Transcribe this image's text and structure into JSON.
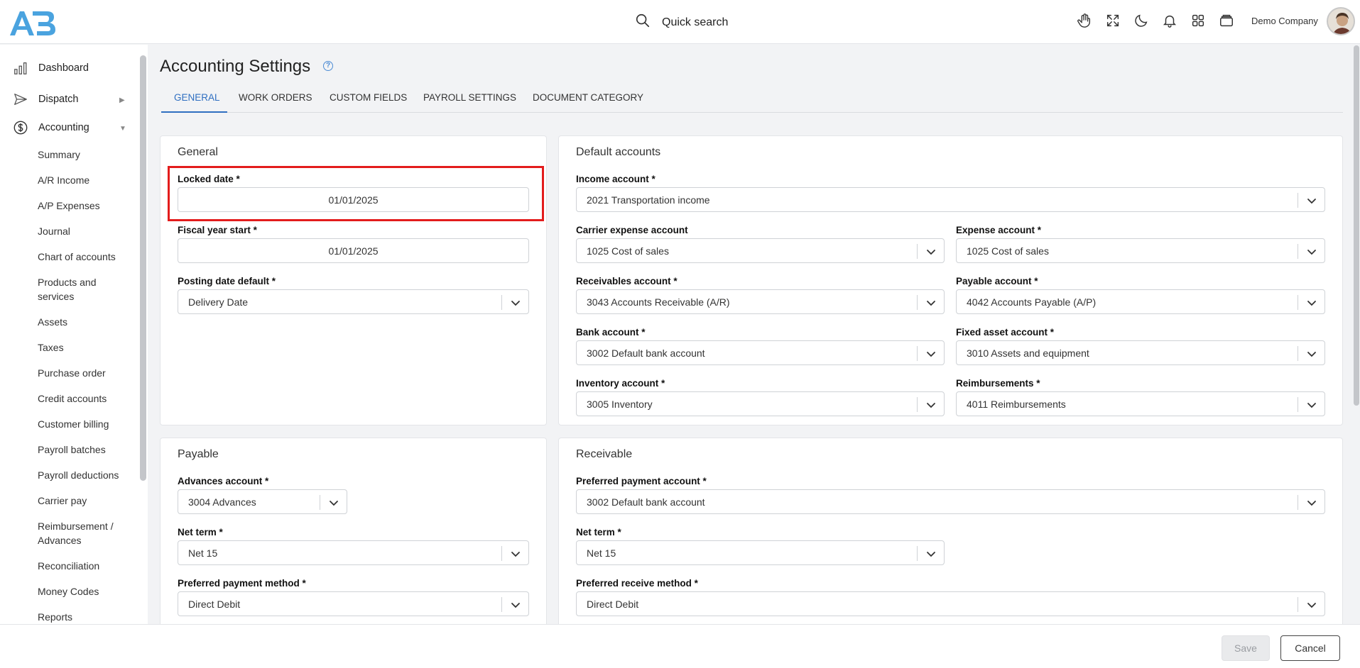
{
  "header": {
    "search_label": "Quick search",
    "company": "Demo Company",
    "icons": [
      "hand-icon",
      "fullscreen-icon",
      "moon-icon",
      "bell-icon",
      "apps-grid-icon",
      "wallet-icon"
    ]
  },
  "sidebar": {
    "main": [
      {
        "label": "Dashboard",
        "icon": "bar-chart-icon"
      },
      {
        "label": "Dispatch",
        "icon": "send-icon",
        "arrow": "▶"
      },
      {
        "label": "Accounting",
        "icon": "dollar-circle-icon",
        "arrow": "▼"
      }
    ],
    "sub": [
      "Summary",
      "A/R Income",
      "A/P Expenses",
      "Journal",
      "Chart of accounts",
      "Products and services",
      "Assets",
      "Taxes",
      "Purchase order",
      "Credit accounts",
      "Customer billing",
      "Payroll batches",
      "Payroll deductions",
      "Carrier pay",
      "Reimbursement / Advances",
      "Reconciliation",
      "Money Codes",
      "Reports"
    ]
  },
  "page": {
    "title": "Accounting Settings",
    "help": "?",
    "tabs": [
      "GENERAL",
      "WORK ORDERS",
      "CUSTOM FIELDS",
      "PAYROLL SETTINGS",
      "DOCUMENT CATEGORY"
    ],
    "active_tab": "GENERAL"
  },
  "general": {
    "title": "General",
    "locked_date": {
      "label": "Locked date *",
      "value": "01/01/2025"
    },
    "fiscal_year_start": {
      "label": "Fiscal year start *",
      "value": "01/01/2025"
    },
    "posting_date_default": {
      "label": "Posting date default *",
      "value": "Delivery Date"
    }
  },
  "default_accounts": {
    "title": "Default accounts",
    "income": {
      "label": "Income account *",
      "value": "2021 Transportation income"
    },
    "carrier_expense": {
      "label": "Carrier expense account",
      "value": "1025 Cost of sales"
    },
    "expense": {
      "label": "Expense account *",
      "value": "1025 Cost of sales"
    },
    "receivables": {
      "label": "Receivables account *",
      "value": "3043 Accounts Receivable (A/R)"
    },
    "payable": {
      "label": "Payable account *",
      "value": "4042 Accounts Payable (A/P)"
    },
    "bank": {
      "label": "Bank account *",
      "value": "3002 Default bank account"
    },
    "fixed_asset": {
      "label": "Fixed asset account *",
      "value": "3010 Assets and equipment"
    },
    "inventory": {
      "label": "Inventory account *",
      "value": "3005 Inventory"
    },
    "reimbursements": {
      "label": "Reimbursements *",
      "value": "4011 Reimbursements"
    }
  },
  "payable": {
    "title": "Payable",
    "advances": {
      "label": "Advances account *",
      "value": "3004 Advances"
    },
    "net_term": {
      "label": "Net term *",
      "value": "Net 15"
    },
    "payment_method": {
      "label": "Preferred payment method *",
      "value": "Direct Debit"
    }
  },
  "receivable": {
    "title": "Receivable",
    "payment_account": {
      "label": "Preferred payment account *",
      "value": "3002 Default bank account"
    },
    "net_term": {
      "label": "Net term *",
      "value": "Net 15"
    },
    "receive_method": {
      "label": "Preferred receive method *",
      "value": "Direct Debit"
    }
  },
  "footer": {
    "save": "Save",
    "cancel": "Cancel"
  },
  "colors": {
    "accent": "#2f6fc1",
    "highlight": "#e31c1c",
    "logo": "#4aa3df"
  }
}
